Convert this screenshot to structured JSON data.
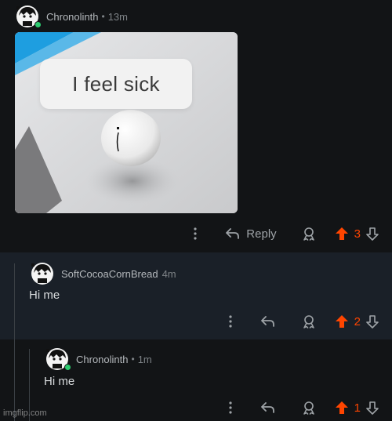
{
  "comments": [
    {
      "username": "Chronolinth",
      "separator": "•",
      "time": "13m",
      "online": true,
      "image_caption": "I feel sick",
      "reply_label": "Reply",
      "vote_count": "3",
      "upvoted": true
    },
    {
      "username": "SoftCocoaCornBread",
      "time": "4m",
      "online": false,
      "text": "Hi me",
      "vote_count": "2",
      "upvoted": true
    },
    {
      "username": "Chronolinth",
      "separator": "•",
      "time": "1m",
      "online": true,
      "text": "Hi me",
      "vote_count": "1",
      "upvoted": true
    }
  ],
  "watermark": "imgflip.com",
  "colors": {
    "background": "#121416",
    "highlight_background": "#1a2028",
    "upvote": "#ff4500",
    "online": "#2dcc70",
    "muted": "#9ea3a7"
  },
  "icons": [
    "more-icon",
    "reply-icon",
    "award-icon",
    "upvote-icon",
    "downvote-icon"
  ]
}
